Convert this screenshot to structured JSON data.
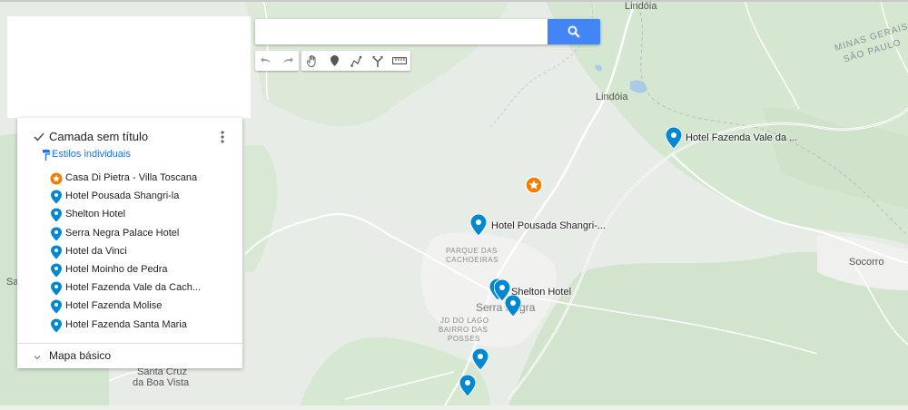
{
  "search": {
    "value": "",
    "placeholder": ""
  },
  "toolbar": {
    "undo_icon": "undo-icon",
    "redo_icon": "redo-icon",
    "hand_icon": "hand-icon",
    "marker_icon": "marker-icon",
    "draw_line_icon": "draw-line-icon",
    "directions_icon": "directions-icon",
    "ruler_icon": "ruler-icon"
  },
  "layer": {
    "title": "Camada sem título",
    "styles_label": "Estilos individuais",
    "items": [
      {
        "label": "Casa Di Pietra - Villa Toscana",
        "icon": "star-marker",
        "color": "#f57c00"
      },
      {
        "label": "Hotel Pousada Shangri-la",
        "icon": "place-marker",
        "color": "#0288d1"
      },
      {
        "label": "Shelton Hotel",
        "icon": "place-marker",
        "color": "#0288d1"
      },
      {
        "label": "Serra Negra Palace Hotel",
        "icon": "place-marker",
        "color": "#0288d1"
      },
      {
        "label": "Hotel da Vinci",
        "icon": "place-marker",
        "color": "#0288d1"
      },
      {
        "label": "Hotel Moinho de Pedra",
        "icon": "place-marker",
        "color": "#0288d1"
      },
      {
        "label": "Hotel Fazenda Vale da Cach...",
        "icon": "place-marker",
        "color": "#0288d1"
      },
      {
        "label": "Hotel Fazenda Molise",
        "icon": "place-marker",
        "color": "#0288d1"
      },
      {
        "label": "Hotel Fazenda Santa Maria",
        "icon": "place-marker",
        "color": "#0288d1"
      }
    ]
  },
  "base_map": {
    "label": "Mapa básico"
  },
  "map": {
    "labels": {
      "lindoia_top": "Lindóia",
      "lindoia": "Lindóia",
      "state_line1": "MINAS GERAIS",
      "state_line2": "SÃO PAULO",
      "socorro": "Socorro",
      "serra_negra": "Serra Negra",
      "parque_line1": "PARQUE DAS",
      "parque_line2": "CACHOEIRAS",
      "jd_line1": "JD DO LAGO",
      "jd_line2": "BAIRRO DAS",
      "jd_line3": "POSSES",
      "santa_cruz_line1": "Santa Cruz",
      "santa_cruz_line2": "da Boa Vista",
      "sa": "Sa"
    },
    "pin_labels": {
      "vale": "Hotel Fazenda Vale da ...",
      "shangri": "Hotel Pousada Shangri-...",
      "shelton": "Shelton Hotel"
    }
  },
  "colors": {
    "accent_blue": "#4285f4",
    "pin_blue": "#0288d1",
    "pin_orange": "#f57c00",
    "link_blue": "#1a73e8"
  }
}
